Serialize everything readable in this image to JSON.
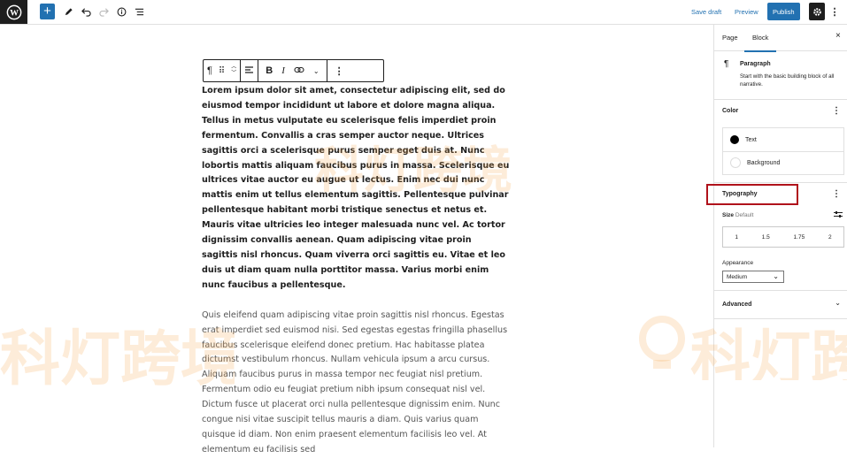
{
  "topbar": {
    "add_label": "+",
    "save_draft": "Save draft",
    "preview": "Preview",
    "publish": "Publish"
  },
  "block_toolbar": {
    "paragraph_icon": "¶",
    "bold": "B",
    "italic": "I"
  },
  "editor": {
    "paragraph1": "Lorem ipsum dolor sit amet, consectetur adipiscing elit, sed do eiusmod tempor incididunt ut labore et dolore magna aliqua. Tellus in metus vulputate eu scelerisque felis imperdiet proin fermentum. Convallis a cras semper auctor neque. Ultrices sagittis orci a scelerisque purus semper eget duis at. Nunc lobortis mattis aliquam faucibus purus in massa. Scelerisque eu ultrices vitae auctor eu augue ut lectus. Enim nec dui nunc mattis enim ut tellus elementum sagittis. Pellentesque pulvinar pellentesque habitant morbi tristique senectus et netus et. Mauris vitae ultricies leo integer malesuada nunc vel. Ac tortor dignissim convallis aenean. Quam adipiscing vitae proin sagittis nisl rhoncus. Quam viverra orci sagittis eu. Vitae et leo duis ut diam quam nulla porttitor massa. Varius morbi enim nunc faucibus a pellentesque.",
    "paragraph2": "Quis eleifend quam adipiscing vitae proin sagittis nisl rhoncus. Egestas erat imperdiet sed euismod nisi. Sed egestas egestas fringilla phasellus faucibus scelerisque eleifend donec pretium. Hac habitasse platea dictumst vestibulum rhoncus. Nullam vehicula ipsum a arcu cursus. Aliquam faucibus purus in massa tempor nec feugiat nisl pretium. Fermentum odio eu feugiat pretium nibh ipsum consequat nisl vel. Dictum fusce ut placerat orci nulla pellentesque dignissim enim. Nunc congue nisi vitae suscipit tellus mauris a diam. Quis varius quam quisque id diam. Non enim praesent elementum facilisis leo vel. At elementum eu facilisis sed"
  },
  "sidebar": {
    "tab_page": "Page",
    "tab_block": "Block",
    "close": "×",
    "block_name": "Paragraph",
    "block_desc": "Start with the basic building block of all narrative.",
    "color_title": "Color",
    "color_text": "Text",
    "color_background": "Background",
    "typography_title": "Typography",
    "size_label": "Size",
    "size_default": "Default",
    "size_options": [
      "1",
      "1.5",
      "1.75",
      "2"
    ],
    "appearance_label": "Appearance",
    "appearance_value": "Medium",
    "advanced_title": "Advanced"
  },
  "watermark": {
    "text_top": "科灯跨境",
    "text_left": "科灯跨境",
    "text_right": "科灯跨"
  },
  "colors": {
    "accent": "#2271b1",
    "highlight": "#b0121b",
    "dark": "#1e1e1e"
  },
  "icons": [
    "wordpress-logo-icon",
    "pen-icon",
    "undo-icon",
    "redo-icon",
    "info-icon",
    "list-view-icon",
    "gear-icon",
    "kebab-icon",
    "drag-icon",
    "move-arrows-icon",
    "align-icon",
    "link-icon",
    "chevron-down-icon",
    "sliders-icon",
    "close-icon"
  ]
}
